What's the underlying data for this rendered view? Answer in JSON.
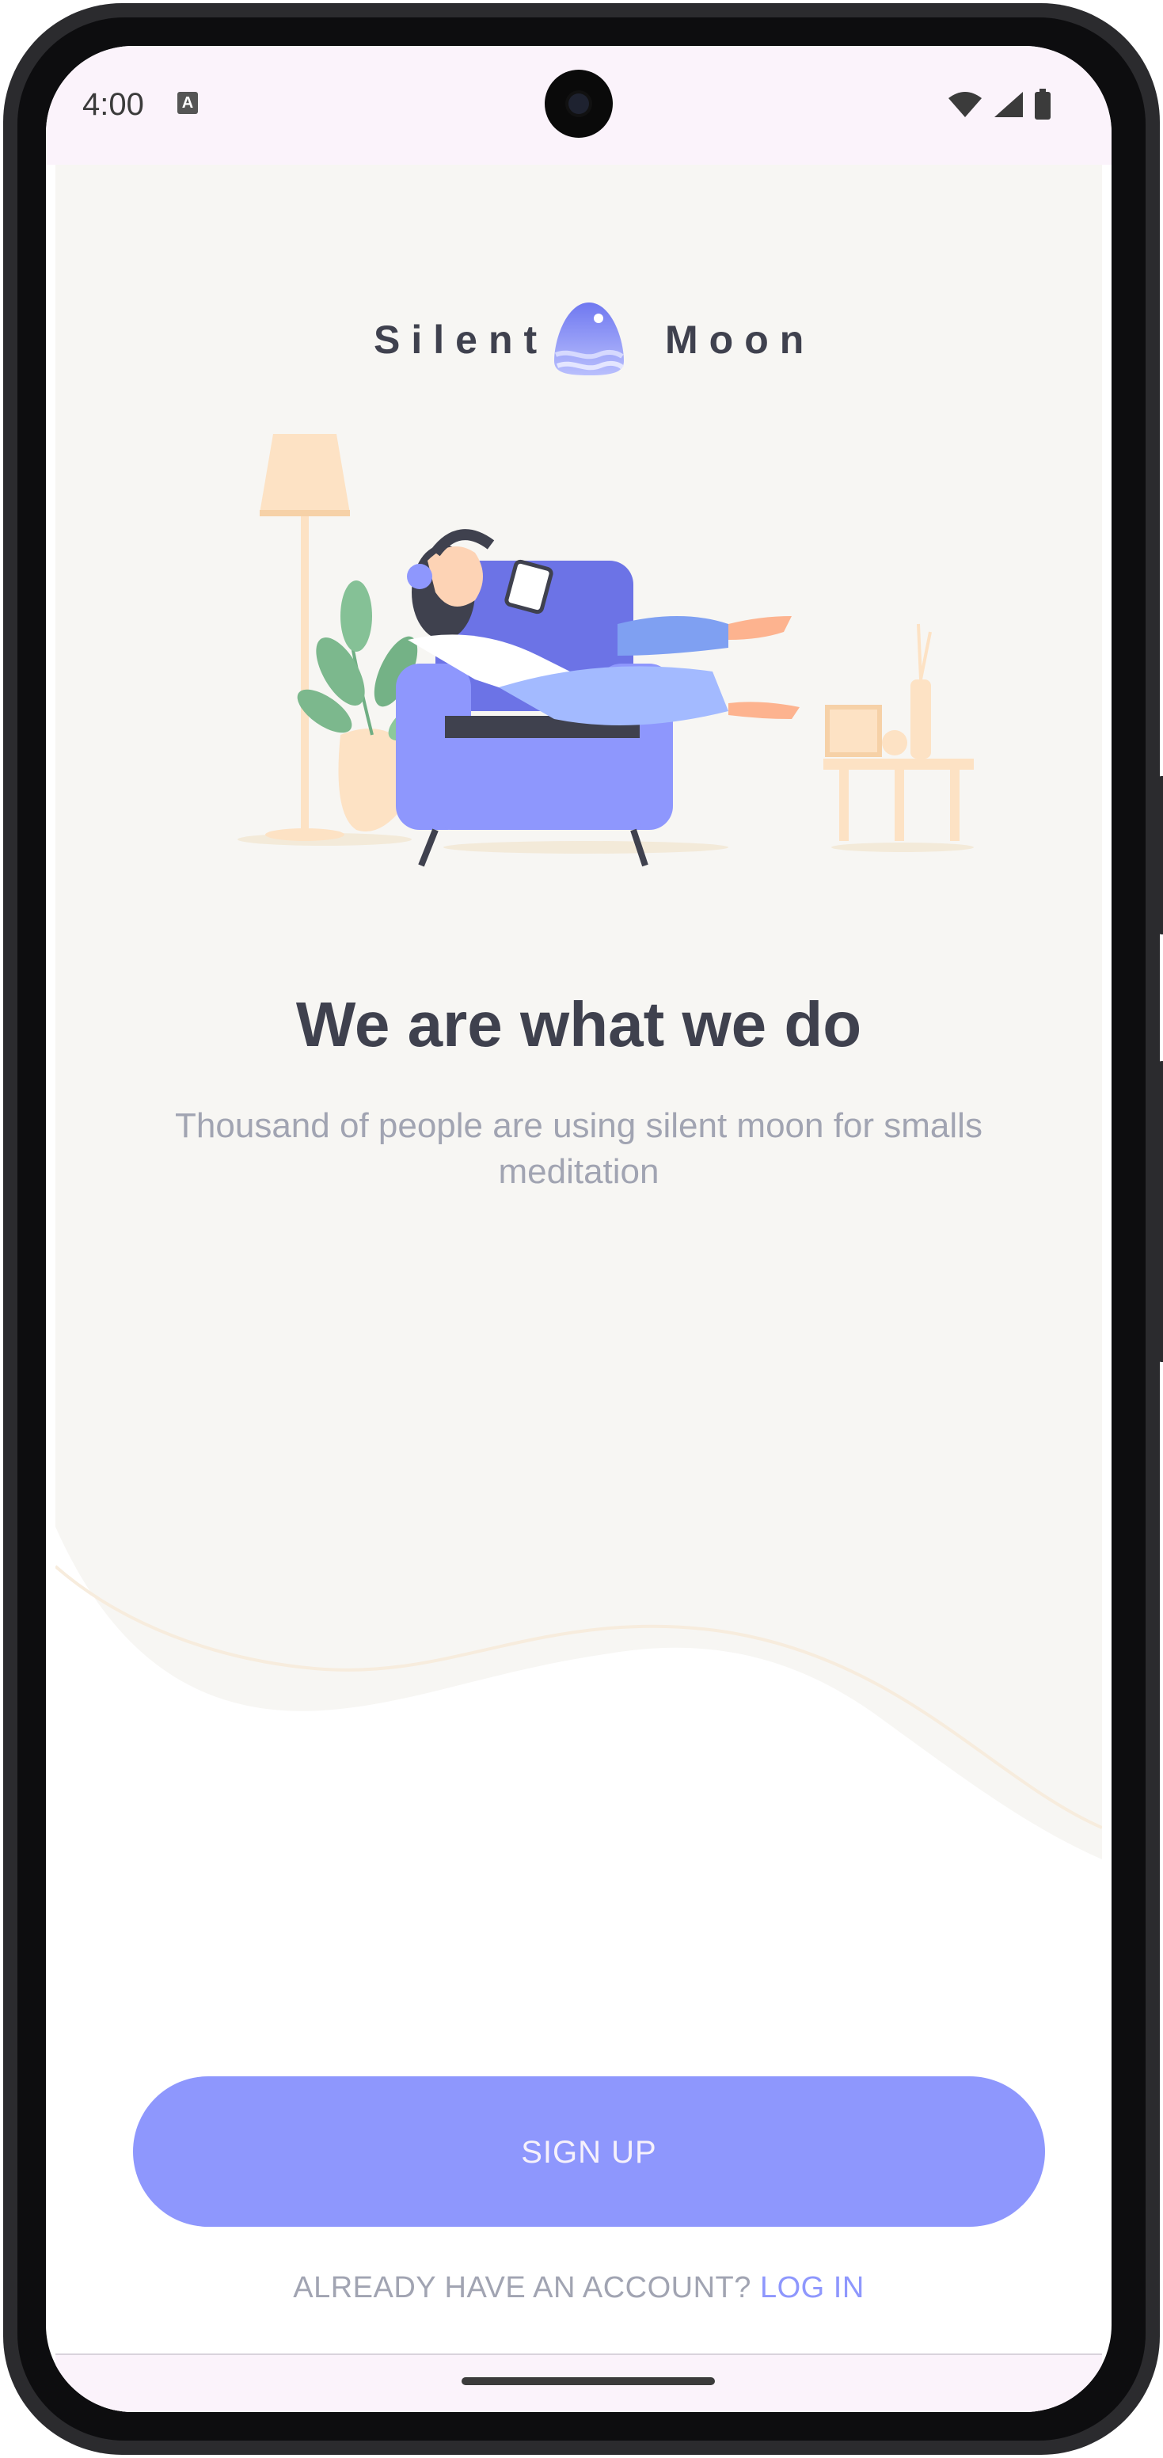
{
  "status_bar": {
    "time": "4:00",
    "notification_icon": "text-a-icon",
    "icons": [
      "wifi-icon",
      "cell-signal-icon",
      "battery-icon"
    ]
  },
  "brand": {
    "name_left": "Silent",
    "name_right": "Moon",
    "logo_icon": "moon-logo-icon"
  },
  "welcome": {
    "title": "We are what we do",
    "subtitle": "Thousand of people are using silent moon for smalls meditation"
  },
  "actions": {
    "signup_label": "SIGN UP",
    "login_prompt": "ALREADY HAVE AN ACCOUNT?",
    "login_link": "LOG IN"
  },
  "colors": {
    "accent": "#8E97FD",
    "text_dark": "#3F414E",
    "text_muted": "#A1A4B2",
    "cream": "#F7F6F3",
    "status_bar": "#FBF3FB"
  }
}
